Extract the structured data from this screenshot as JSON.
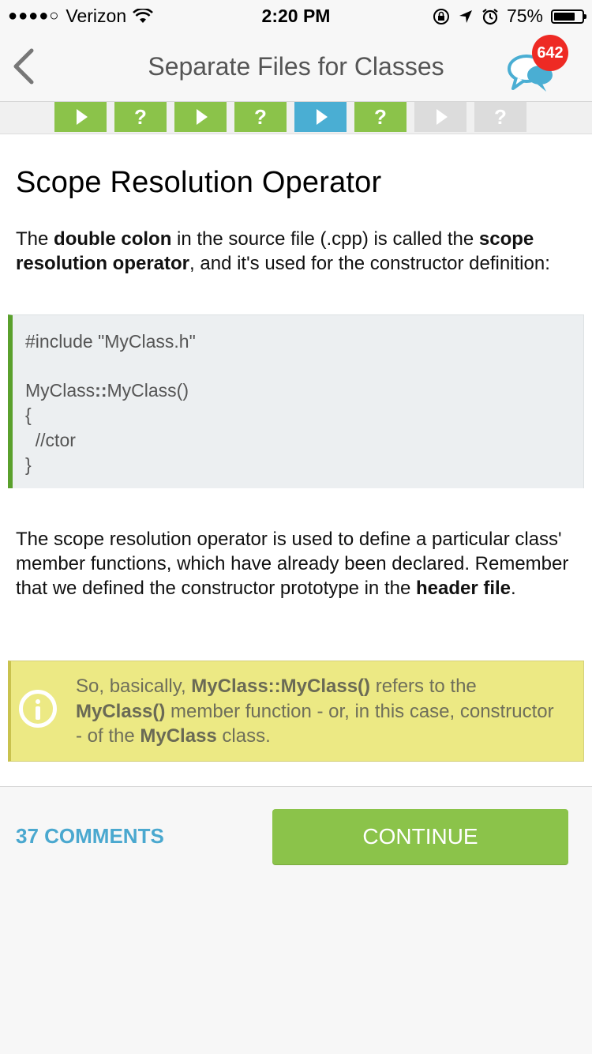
{
  "status_bar": {
    "signal": "●●●●○",
    "carrier": "Verizon",
    "time": "2:20 PM",
    "battery": "75%",
    "battery_level": 0.75
  },
  "nav": {
    "title": "Separate Files for Classes",
    "badge_count": "642"
  },
  "progress": {
    "steps": [
      {
        "kind": "lesson",
        "state": "done"
      },
      {
        "kind": "quiz",
        "state": "done"
      },
      {
        "kind": "lesson",
        "state": "done"
      },
      {
        "kind": "quiz",
        "state": "done"
      },
      {
        "kind": "lesson",
        "state": "current"
      },
      {
        "kind": "quiz",
        "state": "done"
      },
      {
        "kind": "lesson",
        "state": "locked"
      },
      {
        "kind": "quiz",
        "state": "locked"
      }
    ],
    "quiz_glyph": "?"
  },
  "lesson": {
    "title": "Scope Resolution Operator",
    "p1": {
      "t1": "The ",
      "b1": "double colon",
      "t2": " in the source file (.cpp) is called the ",
      "b2": "scope resolution operator",
      "t3": ", and it's used for the constructor definition:"
    },
    "code": {
      "line1": "#include \"MyClass.h\"",
      "line2_a": "MyClass",
      "line2_op": "::",
      "line2_b": "MyClass()",
      "line3": "{",
      "line4": "  //ctor",
      "line5": "}"
    },
    "p2": {
      "t1": "The scope resolution operator is used to define a particular class' member functions, which have already been declared. Remember that we defined the constructor prototype in the ",
      "b1": "header file",
      "t2": "."
    },
    "note": {
      "t1": "So, basically, ",
      "b1": "MyClass::MyClass()",
      "t2": " refers to the ",
      "b2": "MyClass()",
      "t3": " member function - or, in this case, constructor - of  the ",
      "b3": "MyClass",
      "t4": " class."
    }
  },
  "footer": {
    "comments_label": "37 COMMENTS",
    "continue_label": "CONTINUE"
  },
  "colors": {
    "done": "#8bc34a",
    "current": "#4aaed3",
    "locked": "#dcdcdc",
    "link": "#4aa8cf",
    "note_bg": "#ece984",
    "badge": "#ee2a24"
  }
}
